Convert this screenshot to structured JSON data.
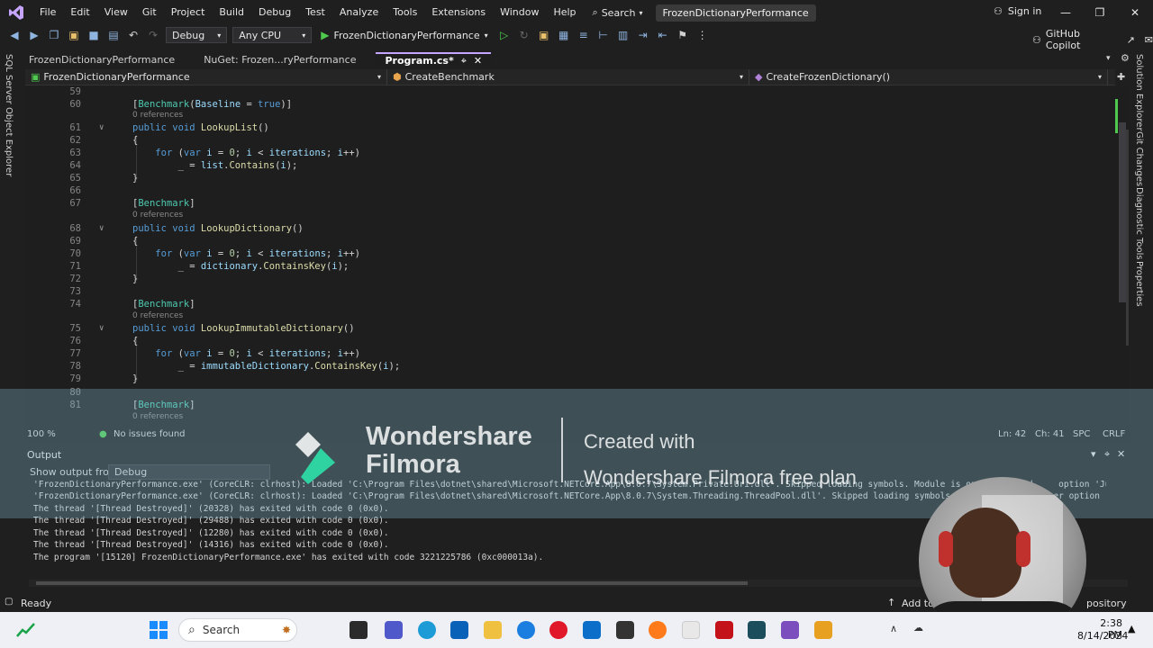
{
  "menubar": {
    "items": [
      "File",
      "Edit",
      "View",
      "Git",
      "Project",
      "Build",
      "Debug",
      "Test",
      "Analyze",
      "Tools",
      "Extensions",
      "Window",
      "Help"
    ],
    "search": "Search",
    "solution_title": "FrozenDictionaryPerformance",
    "signin": "Sign in"
  },
  "toolbar": {
    "config": "Debug",
    "platform": "Any CPU",
    "startup": "FrozenDictionaryPerformance",
    "copilot": "GitHub Copilot"
  },
  "tabs": [
    {
      "label": "FrozenDictionaryPerformance"
    },
    {
      "label": "NuGet: Frozen...ryPerformance"
    },
    {
      "label": "Program.cs*"
    }
  ],
  "navbar": {
    "project": "FrozenDictionaryPerformance",
    "class": "CreateBenchmark",
    "member": "CreateFrozenDictionary()"
  },
  "side": {
    "left": "SQL Server Object Explorer",
    "right": [
      "Solution Explorer",
      "Git Changes",
      "Diagnostic Tools",
      "Properties"
    ]
  },
  "editor": {
    "refs_label": "0 references"
  },
  "edit_status": {
    "zoom": "100 %",
    "issues": "No issues found",
    "line": "Ln: 42",
    "col": "Ch: 41",
    "mode": "SPC",
    "eol": "CRLF"
  },
  "output": {
    "title": "Output",
    "show_from_label": "Show output from:",
    "show_from_value": "Debug",
    "lines": [
      "'FrozenDictionaryPerformance.exe' (CoreCLR: clrhost): Loaded 'C:\\Program Files\\dotnet\\shared\\Microsoft.NETCore.App\\8.0.7\\System.Private.Uri.dll'. Skipped loading symbols. Module is optimized and     option 'Just My C",
      "'FrozenDictionaryPerformance.exe' (CoreCLR: clrhost): Loaded 'C:\\Program Files\\dotnet\\shared\\Microsoft.NETCore.App\\8.0.7\\System.Threading.ThreadPool.dll'. Skipped loading symbols. Module is       ager option '",
      "The thread '[Thread Destroyed]' (20328) has exited with code 0 (0x0).",
      "The thread '[Thread Destroyed]' (29488) has exited with code 0 (0x0).",
      "The thread '[Thread Destroyed]' (12280) has exited with code 0 (0x0).",
      "The thread '[Thread Destroyed]' (14316) has exited with code 0 (0x0).",
      "The program '[15120] FrozenDictionaryPerformance.exe' has exited with code 3221225786 (0xc000013a)."
    ]
  },
  "watermark": {
    "brand_line1": "Wondershare",
    "brand_line2": "Filmora",
    "created_line1": "Created with",
    "created_line2": "Wondershare Filmora free plan"
  },
  "statusbar": {
    "ready": "Ready",
    "add_to": "Add to",
    "repository": "pository"
  },
  "taskbar": {
    "search": "Search",
    "time": "2:38 PM",
    "date": "8/14/2024"
  },
  "colors": {
    "accent": "#c5a5ff",
    "keyword": "#569cd6",
    "type": "#4ec9b0",
    "method": "#dcdcaa",
    "variable": "#9cdcfe",
    "number": "#b5cea8"
  }
}
